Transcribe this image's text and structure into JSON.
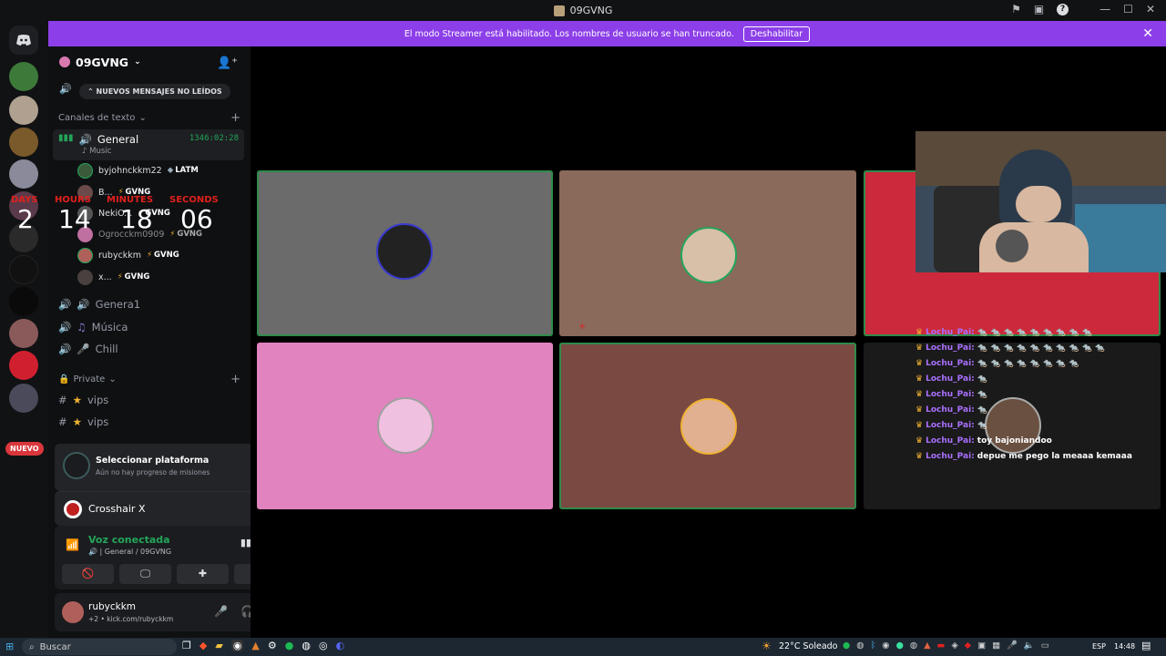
{
  "window": {
    "title": "09GVNG"
  },
  "banner": {
    "text": "El modo Streamer está habilitado. Los nombres de usuario se han truncado.",
    "button": "Deshabilitar"
  },
  "server": {
    "name": "09GVNG",
    "unread_pill": "NUEVOS MENSAJES NO LEÍDOS"
  },
  "categories": {
    "text": "Canales de texto",
    "private": "Private"
  },
  "channels": {
    "general": {
      "name": "General",
      "timer": "1346:02:28",
      "activity": "Music"
    },
    "general1": "Genera1",
    "musica": "Música",
    "chill": "Chill",
    "vips1": "vips",
    "vips2": "vips"
  },
  "members": [
    {
      "name": "byjohnckkm22",
      "tag": "LATM",
      "tag_icon": "gem"
    },
    {
      "name": "B...",
      "tag": "GVNG",
      "tag_icon": "bolt"
    },
    {
      "name": "NekiO...",
      "tag": "GVNG",
      "tag_icon": "bolt"
    },
    {
      "name": "Ogrocckm0909",
      "tag": "GVNG",
      "tag_icon": "bolt"
    },
    {
      "name": "rubyckkm",
      "tag": "GVNG",
      "tag_icon": "bolt"
    },
    {
      "name": "x...",
      "tag": "GVNG",
      "tag_icon": "bolt"
    }
  ],
  "countdown": {
    "days_label": "DAYS",
    "days": "2",
    "hours_label": "HOURS",
    "hours": "14",
    "minutes_label": "MINUTES",
    "minutes": "18",
    "seconds_label": "SECONDS",
    "seconds": "06"
  },
  "server_badge": "NUEVO",
  "quest": {
    "title": "Seleccionar plataforma",
    "subtitle": "Aún no hay progreso de misiones"
  },
  "activity": {
    "name": "Crosshair X"
  },
  "voice": {
    "status": "Voz conectada",
    "location": "General / 09GVNG"
  },
  "user": {
    "name": "rubyckkm",
    "status": "+2 • kick.com/rubyckkm"
  },
  "chat": [
    {
      "user": "Lochu_Pai:",
      "msg": "🐀 🐀 🐀 🐀 🐀 🐀 🐀 🐀 🐀"
    },
    {
      "user": "Lochu_Pai:",
      "msg": "🐀 🐀 🐀 🐀 🐀 🐀 🐀 🐀 🐀 🐀"
    },
    {
      "user": "Lochu_Pai:",
      "msg": "🐀 🐀 🐀 🐀 🐀 🐀 🐀 🐀"
    },
    {
      "user": "Lochu_Pai:",
      "msg": "🐀"
    },
    {
      "user": "Lochu_Pai:",
      "msg": "🐀"
    },
    {
      "user": "Lochu_Pai:",
      "msg": "🐀"
    },
    {
      "user": "Lochu_Pai:",
      "msg": "🐀"
    },
    {
      "user": "Lochu_Pai:",
      "msg": "toy bajoniandoo"
    },
    {
      "user": "Lochu_Pai:",
      "msg": "depue me pego la meaaa kemaaa"
    }
  ],
  "taskbar": {
    "search": "Buscar",
    "weather": "22°C  Soleado",
    "lang": "ESP",
    "time": "14:48"
  },
  "colors": {
    "banner": "#8c3fe8",
    "speaking": "#2f8a4a",
    "tile1": "#6b6b6b",
    "tile2": "#8a6a5a",
    "tile3": "#cc2a3c",
    "tile4": "#e083be",
    "tile5": "#7a4a42",
    "tile6": "#1a1a1a"
  }
}
